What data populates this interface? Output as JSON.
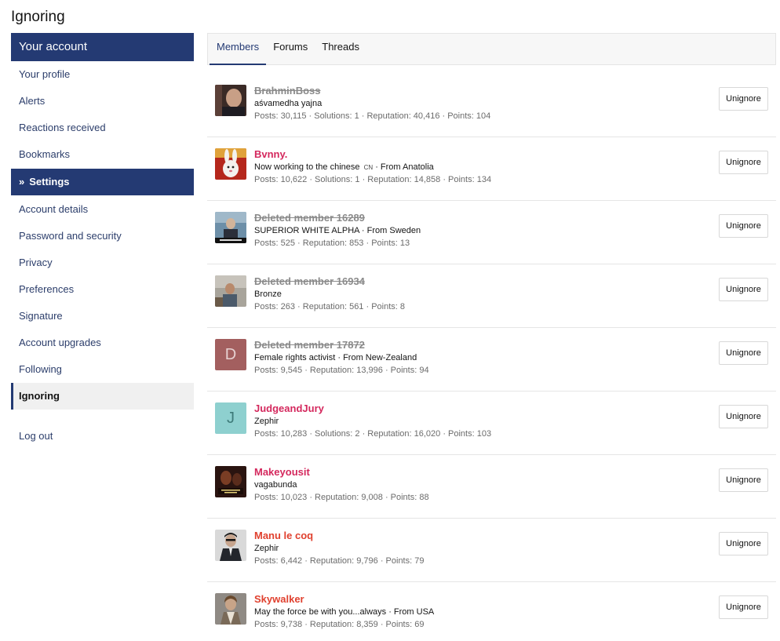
{
  "page": {
    "title": "Ignoring"
  },
  "sidebar": {
    "heading": "Your account",
    "items_top": [
      {
        "label": "Your profile"
      },
      {
        "label": "Alerts"
      },
      {
        "label": "Reactions received"
      },
      {
        "label": "Bookmarks"
      }
    ],
    "settings_heading": "Settings",
    "settings_icon": "double-chevron-right-icon",
    "items_settings": [
      {
        "label": "Account details"
      },
      {
        "label": "Password and security"
      },
      {
        "label": "Privacy"
      },
      {
        "label": "Preferences"
      },
      {
        "label": "Signature"
      },
      {
        "label": "Account upgrades"
      },
      {
        "label": "Following"
      },
      {
        "label": "Ignoring",
        "active": true
      }
    ],
    "logout": "Log out"
  },
  "tabs": [
    {
      "label": "Members",
      "active": true
    },
    {
      "label": "Forums"
    },
    {
      "label": "Threads"
    }
  ],
  "members": [
    {
      "name": "BrahminBoss",
      "deleted": true,
      "title": "aśvamedha yajna",
      "stats": "Posts: 30,115 · Solutions: 1 · Reputation: 40,416 · Points: 104",
      "button": "Unignore",
      "avatar": "photo"
    },
    {
      "name": "Bvnny.",
      "title": "Now working to the chinese",
      "title_badge": "CN",
      "title_suffix": " · From Anatolia",
      "stats": "Posts: 10,622 · Solutions: 1 · Reputation: 14,858 · Points: 134",
      "button": "Unignore",
      "avatar": "photo"
    },
    {
      "name": "Deleted member 16289",
      "deleted": true,
      "title": "SUPERIOR WHITE ALPHA · From Sweden",
      "stats": "Posts: 525 · Reputation: 853 · Points: 13",
      "button": "Unignore",
      "avatar": "photo"
    },
    {
      "name": "Deleted member 16934",
      "deleted": true,
      "title": "Bronze",
      "stats": "Posts: 263 · Reputation: 561 · Points: 8",
      "button": "Unignore",
      "avatar": "photo"
    },
    {
      "name": "Deleted member 17872",
      "deleted": true,
      "title": "Female rights activist · From New-Zealand",
      "stats": "Posts: 9,545 · Reputation: 13,996 · Points: 94",
      "button": "Unignore",
      "avatar": "letter",
      "letter": "D"
    },
    {
      "name": "JudgeandJury",
      "title": "Zephir",
      "stats": "Posts: 10,283 · Solutions: 2 · Reputation: 16,020 · Points: 103",
      "button": "Unignore",
      "avatar": "letter",
      "letter": "J"
    },
    {
      "name": "Makeyousit",
      "title": "vagabunda",
      "stats": "Posts: 10,023 · Reputation: 9,008 · Points: 88",
      "button": "Unignore",
      "avatar": "photo"
    },
    {
      "name": "Manu le coq",
      "title": "Zephir",
      "stats": "Posts: 6,442 · Reputation: 9,796 · Points: 79",
      "button": "Unignore",
      "avatar": "photo",
      "color": "orange"
    },
    {
      "name": "Skywalker",
      "title": "May the force be with you...always · From USA",
      "stats": "Posts: 9,738 · Reputation: 8,359 · Points: 69",
      "button": "Unignore",
      "avatar": "photo",
      "color": "orange"
    }
  ],
  "colors": {
    "accent": "#243a73",
    "username": "#d4285d",
    "username_alt": "#e0412f",
    "deleted": "#8a8a8a"
  }
}
